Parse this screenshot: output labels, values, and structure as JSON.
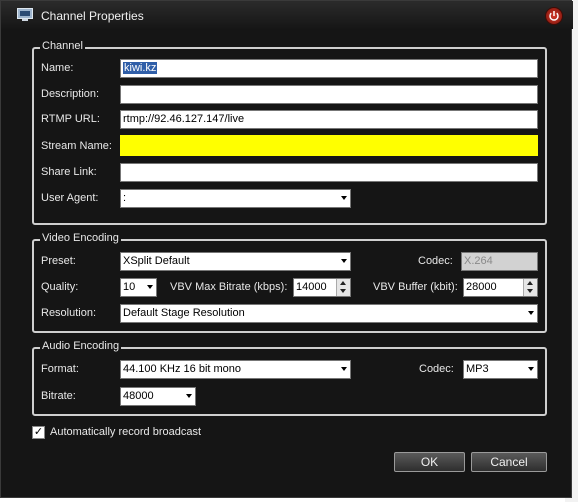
{
  "window": {
    "title": "Channel Properties"
  },
  "channel": {
    "legend": "Channel",
    "name_label": "Name:",
    "name_value": "kiwi.kz",
    "description_label": "Description:",
    "description_value": "",
    "rtmp_label": "RTMP URL:",
    "rtmp_value": "rtmp://92.46.127.147/live",
    "stream_label": "Stream Name:",
    "stream_value": "",
    "share_label": "Share Link:",
    "share_value": "",
    "agent_label": "User Agent:",
    "agent_value": ":"
  },
  "video": {
    "legend": "Video Encoding",
    "preset_label": "Preset:",
    "preset_value": "XSplit Default",
    "codec_label": "Codec:",
    "codec_value": "X.264",
    "quality_label": "Quality:",
    "quality_value": "10",
    "vbv_max_label": "VBV Max Bitrate (kbps):",
    "vbv_max_value": "14000",
    "vbv_buffer_label": "VBV Buffer (kbit):",
    "vbv_buffer_value": "28000",
    "resolution_label": "Resolution:",
    "resolution_value": "Default Stage Resolution"
  },
  "audio": {
    "legend": "Audio Encoding",
    "format_label": "Format:",
    "format_value": "44.100 KHz 16 bit mono",
    "codec_label": "Codec:",
    "codec_value": "MP3",
    "bitrate_label": "Bitrate:",
    "bitrate_value": "48000"
  },
  "options": {
    "auto_record_label": "Automatically record broadcast",
    "auto_record_checked": true
  },
  "buttons": {
    "ok": "OK",
    "cancel": "Cancel"
  }
}
